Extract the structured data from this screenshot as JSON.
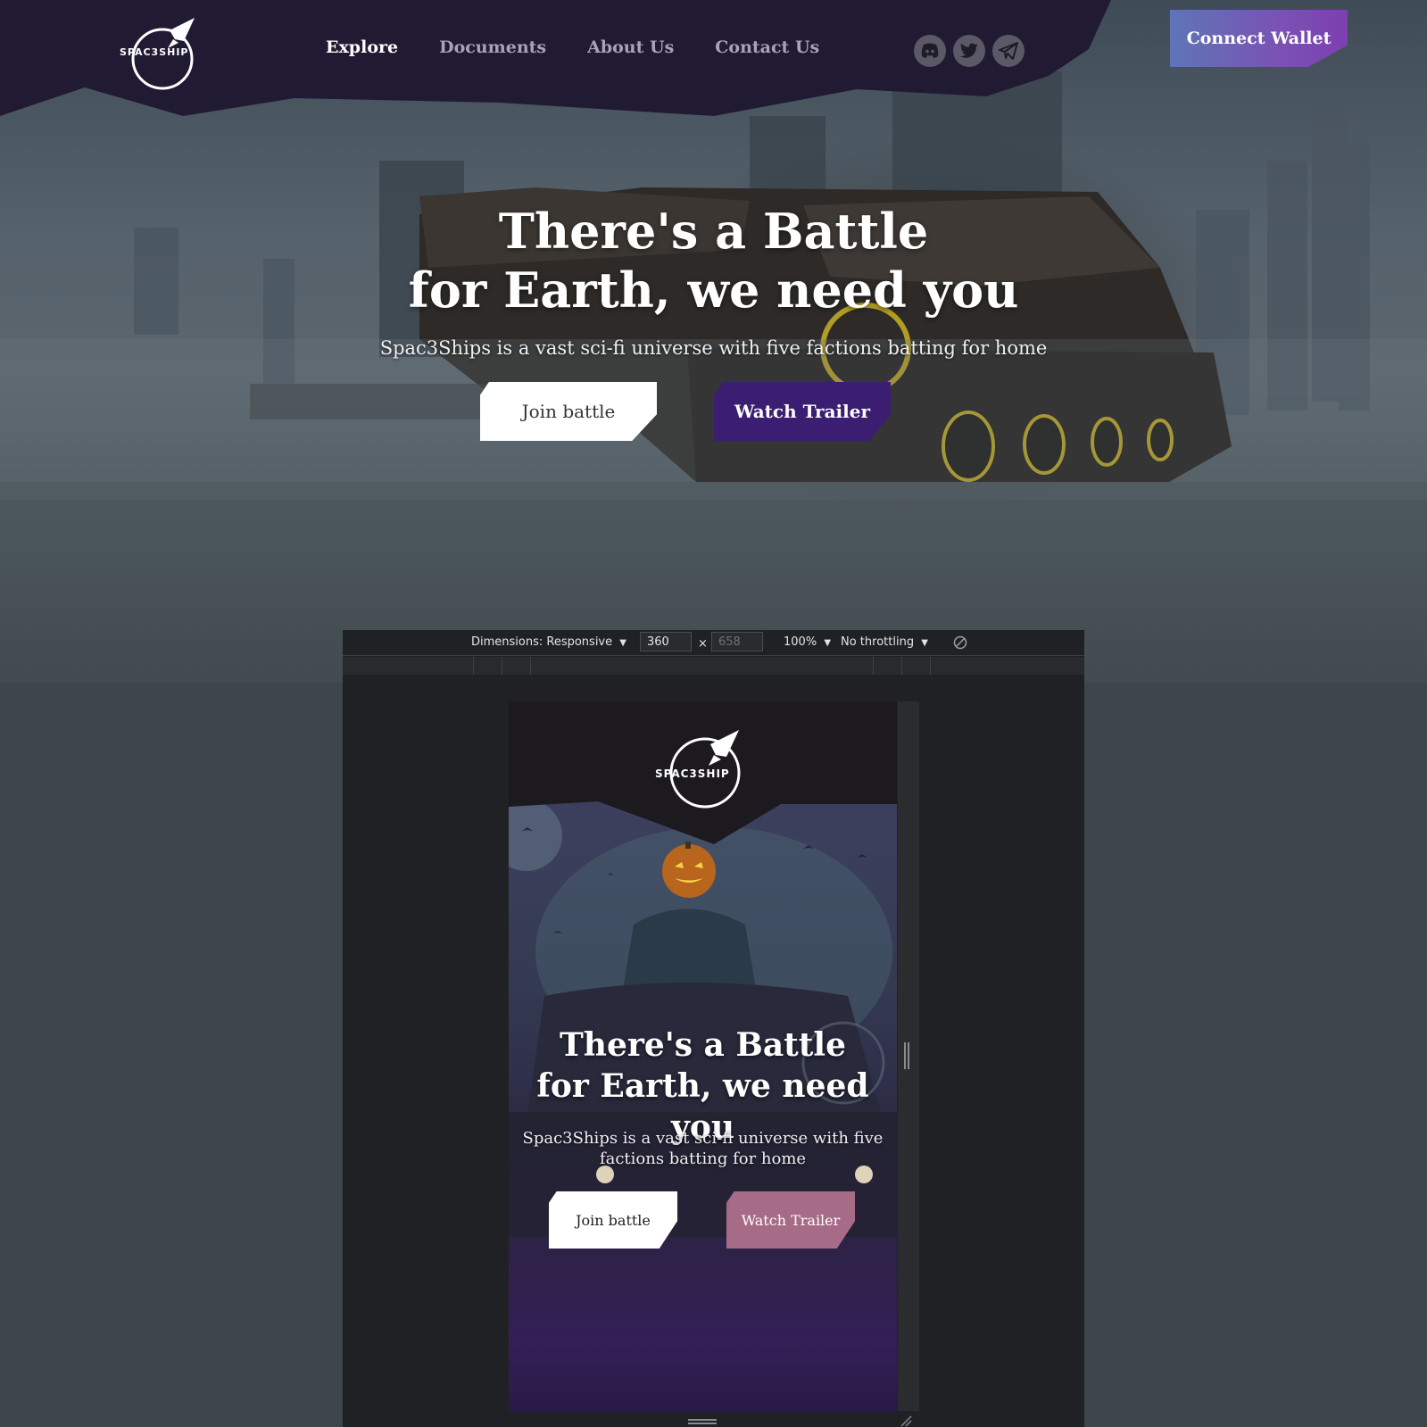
{
  "desktop": {
    "logo_text": "SPAC3SHIP",
    "nav": [
      {
        "label": "Explore",
        "active": true
      },
      {
        "label": "Documents",
        "active": false
      },
      {
        "label": "About Us",
        "active": false
      },
      {
        "label": "Contact Us",
        "active": false
      }
    ],
    "socials": [
      "discord-icon",
      "twitter-icon",
      "telegram-icon"
    ],
    "connect_label": "Connect Wallet",
    "hero_title_line1": "There's a Battle",
    "hero_title_line2": "for Earth, we need you",
    "hero_subtitle": "Spac3Ships is a vast sci-fi universe with five factions batting for home",
    "join_label": "Join battle",
    "trailer_label": "Watch Trailer",
    "colors": {
      "nav_bg": "#201a33",
      "trailer_btn": "#3b1d72",
      "connect_from": "#5e75b6",
      "connect_to": "#7c3fb0"
    }
  },
  "devtools": {
    "dimensions_label": "Dimensions: Responsive",
    "width_value": "360",
    "times_symbol": "×",
    "height_placeholder": "658",
    "zoom_label": "100%",
    "throttle_label": "No throttling",
    "dropdown_glyph": "▼",
    "rotate_icon": "rotate-icon"
  },
  "mobile": {
    "logo_text": "SPAC3SHIP",
    "hero_title_line1": "There's a Battle",
    "hero_title_line2": "for Earth, we need you",
    "hero_subtitle": "Spac3Ships is a vast sci-fi universe with five factions batting for home",
    "join_label": "Join battle",
    "trailer_label": "Watch Trailer",
    "colors": {
      "header_bg": "#1c1a1f",
      "trailer_btn": "#a66b86"
    }
  }
}
